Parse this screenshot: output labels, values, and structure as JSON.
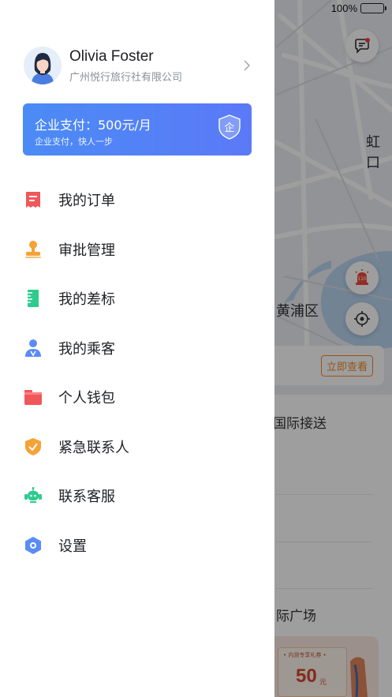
{
  "status_bar": {
    "battery_text": "100%"
  },
  "map": {
    "labels": {
      "hongkou": "虹口",
      "huangpu": "黄浦区"
    },
    "banner_button": "立即查看",
    "sheet": {
      "intl_transfer": "国际接送",
      "intl_plaza": "际广场"
    },
    "promo": {
      "caption": "• 内测专享礼券 •",
      "amount": "50",
      "unit": "元"
    }
  },
  "profile": {
    "name": "Olivia Foster",
    "company": "广州悦行旅行社有限公司"
  },
  "pay_card": {
    "title": "企业支付：500元/月",
    "subtitle": "企业支付，快人一步",
    "badge_char": "企"
  },
  "menu": {
    "items": [
      {
        "label": "我的订单",
        "icon": "receipt-icon",
        "color": "#f0575b"
      },
      {
        "label": "审批管理",
        "icon": "stamp-icon",
        "color": "#f5a236"
      },
      {
        "label": "我的差标",
        "icon": "ruler-icon",
        "color": "#2ecb8f"
      },
      {
        "label": "我的乘客",
        "icon": "passenger-icon",
        "color": "#5b8cf5"
      },
      {
        "label": "个人钱包",
        "icon": "wallet-icon",
        "color": "#f0575b"
      },
      {
        "label": "紧急联系人",
        "icon": "shield-check-icon",
        "color": "#f5a236"
      },
      {
        "label": "联系客服",
        "icon": "headset-icon",
        "color": "#2ecb8f"
      },
      {
        "label": "设置",
        "icon": "settings-hex-icon",
        "color": "#5b8cf5"
      }
    ]
  },
  "colors": {
    "accent": "#4b8bf5",
    "orange": "#f08c2b"
  }
}
